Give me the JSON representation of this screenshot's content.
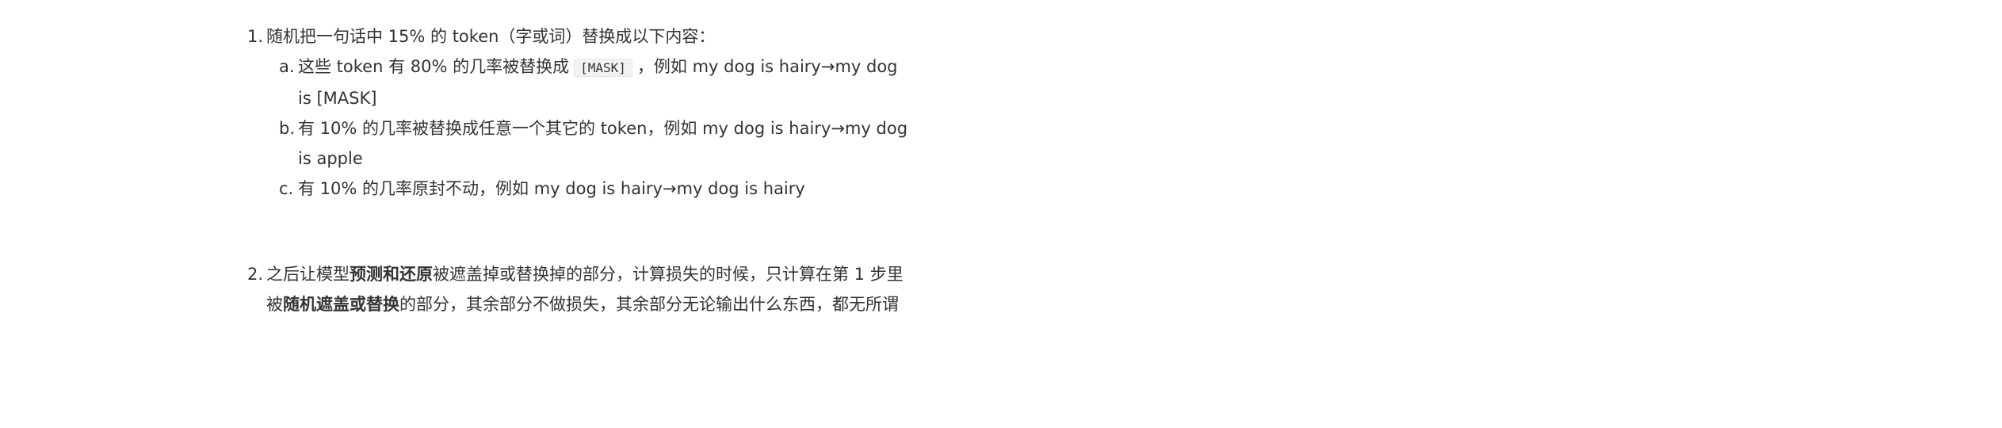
{
  "list": {
    "item1": {
      "number": "1.",
      "text": "随机把一句话中 15% 的 token（字或词）替换成以下内容：",
      "subs": [
        {
          "label": "a.",
          "before": "这些 token 有 80% 的几率被替换成",
          "code": "[MASK]",
          "after": "，例如 my dog is hairy→my dog is [MASK]"
        },
        {
          "label": "b.",
          "text": "有 10% 的几率被替换成任意一个其它的 token，例如 my dog is hairy→my dog is apple"
        },
        {
          "label": "c.",
          "text": "有 10% 的几率原封不动，例如 my dog is hairy→my dog is hairy"
        }
      ]
    },
    "item2": {
      "number": "2.",
      "t1": "之后让模型",
      "b1": "预测和还原",
      "t2": "被遮盖掉或替换掉的部分，计算损失的时候，只计算在第 1 步里被",
      "b2": "随机遮盖或替换",
      "t3": "的部分，其余部分不做损失，其余部分无论输出什么东西，都无所谓"
    }
  }
}
